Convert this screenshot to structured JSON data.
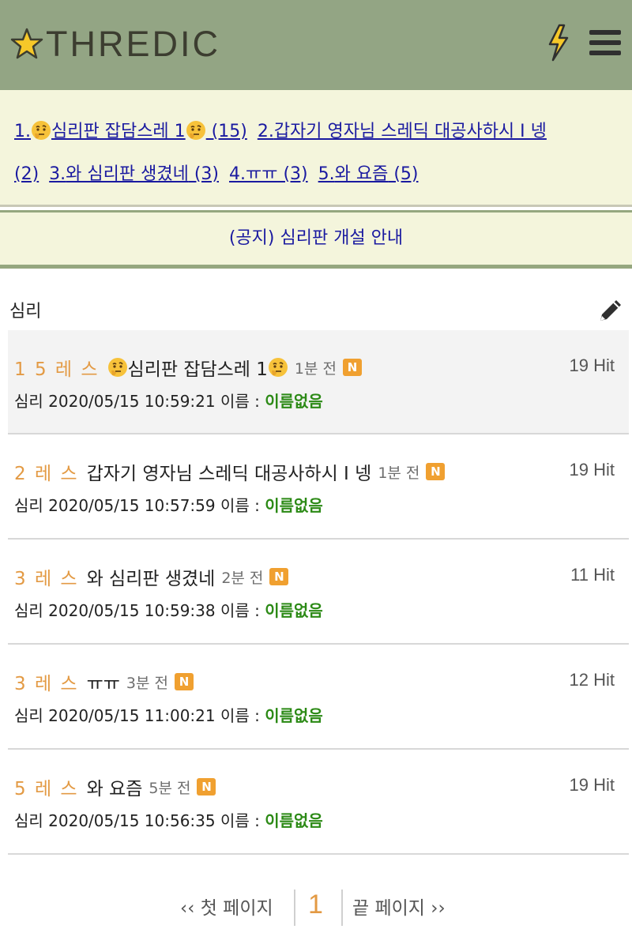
{
  "header": {
    "logo_text": "THREDIC",
    "icons": {
      "logo": "star-icon",
      "bolt": "lightning-icon",
      "menu": "hamburger-menu-icon"
    }
  },
  "hot_links": [
    {
      "prefix": "1.",
      "icon_before": "thinking-face-emoji",
      "text": "심리판 잡담스레 1",
      "icon_after": "thinking-face-emoji",
      "count": " (15)"
    },
    {
      "prefix": "2.",
      "text": "갑자기 영자님 스레딕 대공사하시 I 넹",
      "count": ""
    },
    {
      "prefix": "",
      "text": "",
      "count": "(2)"
    },
    {
      "prefix": "3.",
      "text": "와 심리판 생겼네",
      "count": " (3)"
    },
    {
      "prefix": "4.",
      "text": "ㅠㅠ",
      "count": " (3)"
    },
    {
      "prefix": "5.",
      "text": "와 요즘",
      "count": " (5)"
    }
  ],
  "notice": {
    "text": "(공지) 심리판 개설 안내"
  },
  "board": {
    "tab_label": "심리",
    "write_icon": "pencil-icon"
  },
  "threads": [
    {
      "res": "1 5 레 스",
      "title": "심리판 잡담스레 1",
      "has_emoji": true,
      "ago": "1분 전",
      "badge": "N",
      "hits": "19 Hit",
      "meta": "심리 2020/05/15 10:59:21 이름 : ",
      "nick": "이름없음"
    },
    {
      "res": "2 레 스",
      "title": "갑자기 영자님 스레딕 대공사하시 I 넹",
      "has_emoji": false,
      "ago": "1분 전",
      "badge": "N",
      "hits": "19 Hit",
      "meta": "심리 2020/05/15 10:57:59 이름 : ",
      "nick": "이름없음"
    },
    {
      "res": "3 레 스",
      "title": "와 심리판 생겼네",
      "has_emoji": false,
      "ago": "2분 전",
      "badge": "N",
      "hits": "11 Hit",
      "meta": "심리 2020/05/15 10:59:38 이름 : ",
      "nick": "이름없음"
    },
    {
      "res": "3 레 스",
      "title": "ㅠㅠ",
      "has_emoji": false,
      "ago": "3분 전",
      "badge": "N",
      "hits": "12 Hit",
      "meta": "심리 2020/05/15 11:00:21 이름 : ",
      "nick": "이름없음"
    },
    {
      "res": "5 레 스",
      "title": "와 요즘",
      "has_emoji": false,
      "ago": "5분 전",
      "badge": "N",
      "hits": "19 Hit",
      "meta": "심리 2020/05/15 10:56:35 이름 : ",
      "nick": "이름없음"
    }
  ],
  "pager": {
    "first": "‹‹ 첫 페이지",
    "current": "1",
    "last": "끝 페이지 ››"
  },
  "colors": {
    "header": "#93a584",
    "panel": "#f4f5dc",
    "link": "#1a1aa0",
    "accent": "#e39a44",
    "nick": "#2c8a16"
  }
}
